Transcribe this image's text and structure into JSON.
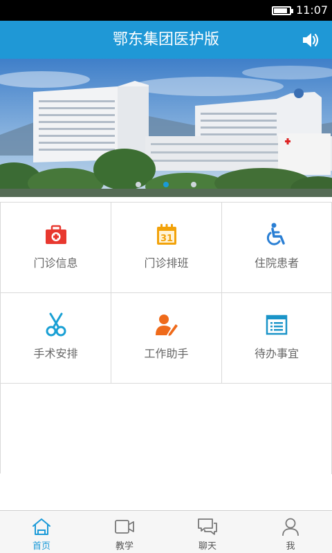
{
  "status_bar": {
    "time": "11:07",
    "battery_level": 0.85
  },
  "header": {
    "title": "鄂东集团医护版"
  },
  "banner": {
    "pages": 3,
    "active_page": 2
  },
  "grid": [
    {
      "label": "门诊信息",
      "icon": "first-aid-kit-icon",
      "color": "#e8382f"
    },
    {
      "label": "门诊排班",
      "icon": "calendar-icon",
      "color": "#f2a20a"
    },
    {
      "label": "住院患者",
      "icon": "wheelchair-icon",
      "color": "#2a7fd4"
    },
    {
      "label": "手术安排",
      "icon": "scissors-icon",
      "color": "#1aa0d4"
    },
    {
      "label": "工作助手",
      "icon": "person-edit-icon",
      "color": "#ef6a1a"
    },
    {
      "label": "待办事宜",
      "icon": "list-icon",
      "color": "#1a94c8"
    }
  ],
  "nav": [
    {
      "label": "首页",
      "icon": "home-icon",
      "active": true
    },
    {
      "label": "教学",
      "icon": "video-icon",
      "active": false
    },
    {
      "label": "聊天",
      "icon": "chat-icon",
      "active": false
    },
    {
      "label": "我",
      "icon": "person-icon",
      "active": false
    }
  ],
  "colors": {
    "accent": "#1f98d6",
    "active": "#1a9ad8"
  }
}
